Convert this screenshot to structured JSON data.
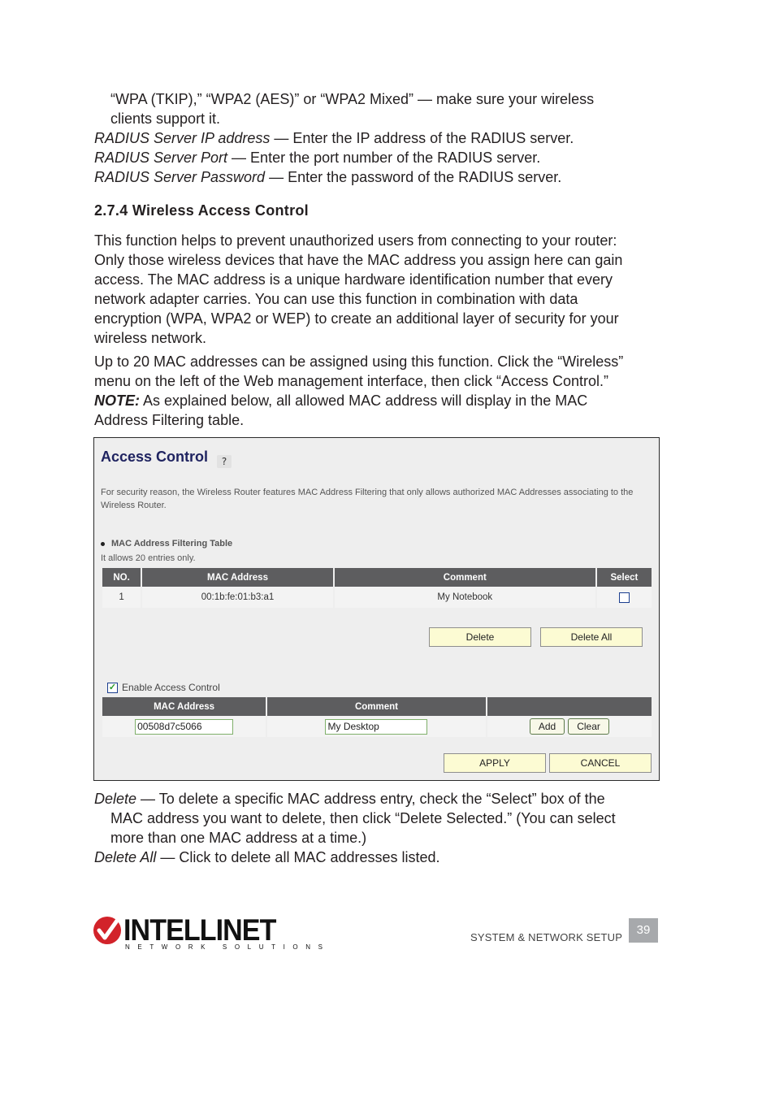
{
  "intro_lines": [
    {
      "text": "“WPA (TKIP),” “WPA2 (AES)” or “WPA2 Mixed” — make sure your wireless"
    },
    {
      "text": "clients support it."
    }
  ],
  "radius_items": [
    {
      "term": "RADIUS Server IP address",
      "desc": " — Enter the IP address of the RADIUS server."
    },
    {
      "term": "RADIUS Server Port",
      "desc": " — Enter the port number of the RADIUS server."
    },
    {
      "term": "RADIUS Server Password",
      "desc": " — Enter the password of the RADIUS server."
    }
  ],
  "section": {
    "heading": "2.7.4  Wireless Access Control",
    "para1": [
      "This function helps to prevent unauthorized users from connecting to your router:",
      "Only those wireless devices that have the MAC address you assign here can gain",
      "access. The MAC address is a unique hardware identification number that every",
      "network adapter carries. You can use this function in combination with data",
      "encryption (WPA, WPA2 or WEP) to create an additional layer of security for your",
      "wireless network."
    ],
    "para2": [
      "Up to 20 MAC addresses can be assigned using this function. Click the “Wireless”",
      "menu on the left of the Web management interface, then click “Access Control.”"
    ],
    "note_label": "NOTE:",
    "note_text": " As explained below, all allowed MAC address will display in the MAC",
    "note_text2": "Address Filtering table."
  },
  "screenshot": {
    "title": "Access Control",
    "help_icon": "help-icon",
    "description": "For security reason, the Wireless Router features MAC Address Filtering that only allows authorized MAC Addresses associating to the Wireless Router.",
    "filter_table_title": "MAC Address Filtering Table",
    "filter_table_note": "It allows 20 entries only.",
    "filter_table": {
      "headers": [
        "NO.",
        "MAC Address",
        "Comment",
        "Select"
      ],
      "rows": [
        {
          "no": "1",
          "mac": "00:1b:fe:01:b3:a1",
          "comment": "My Notebook",
          "selected": false
        }
      ]
    },
    "delete_label": "Delete",
    "delete_all_label": "Delete All",
    "enable_label": "Enable Access Control",
    "enable_checked": true,
    "add_table": {
      "headers": [
        "MAC Address",
        "Comment",
        ""
      ],
      "mac_value": "00508d7c5066",
      "comment_value": "My Desktop"
    },
    "add_label": "Add",
    "clear_label": "Clear",
    "apply_label": "APPLY",
    "cancel_label": "CANCEL"
  },
  "definitions": [
    {
      "term": "Delete",
      "lines": [
        " — To delete a specific MAC address entry, check the “Select” box of the",
        "MAC address you want to delete, then click “Delete Selected.” (You can select",
        "more than one MAC address at a time.)"
      ]
    },
    {
      "term": "Delete All",
      "lines": [
        " — Click to delete all MAC addresses listed."
      ]
    }
  ],
  "footer": {
    "brand": "INTELLINET",
    "brand_sub": "NETWORK SOLUTIONS",
    "section_label": "SYSTEM & NETWORK SETUP",
    "page_number": "39",
    "brand_color": "#d2232a"
  }
}
